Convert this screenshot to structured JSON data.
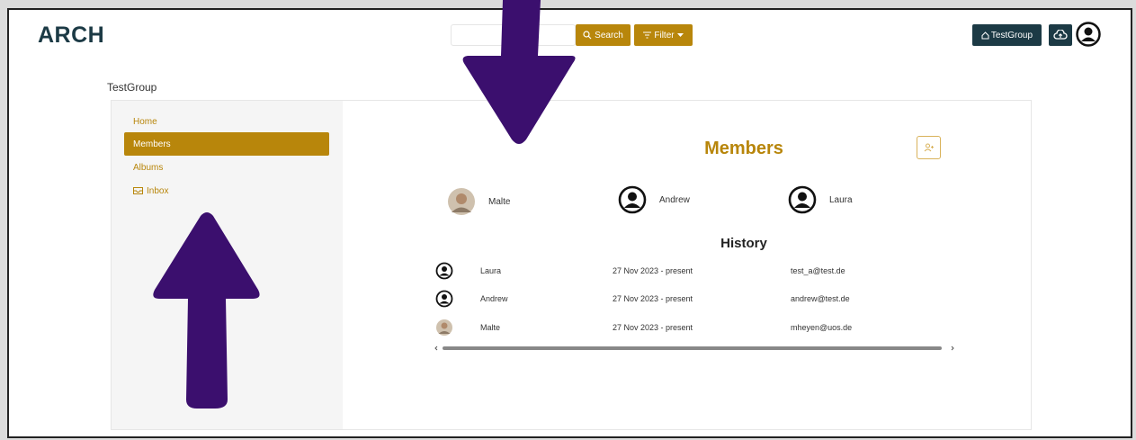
{
  "app": {
    "logo": "ARCH"
  },
  "header": {
    "search_placeholder": "",
    "search_label": "Search",
    "filter_label": "Filter",
    "group_button_label": "TestGroup"
  },
  "group": {
    "name": "TestGroup"
  },
  "sidebar": {
    "items": [
      {
        "label": "Home",
        "active": false
      },
      {
        "label": "Members",
        "active": true
      },
      {
        "label": "Albums",
        "active": false
      },
      {
        "label": "Inbox",
        "active": false
      }
    ]
  },
  "main": {
    "title": "Members",
    "members": [
      {
        "name": "Malte",
        "avatar": "photo"
      },
      {
        "name": "Andrew",
        "avatar": "default"
      },
      {
        "name": "Laura",
        "avatar": "default"
      }
    ],
    "history_title": "History",
    "history": [
      {
        "name": "Laura",
        "period": "27 Nov 2023 - present",
        "email": "test_a@test.de",
        "avatar": "default"
      },
      {
        "name": "Andrew",
        "period": "27 Nov 2023 - present",
        "email": "andrew@test.de",
        "avatar": "default"
      },
      {
        "name": "Malte",
        "period": "27 Nov 2023 - present",
        "email": "mheyen@uos.de",
        "avatar": "photo"
      }
    ]
  },
  "colors": {
    "accent": "#b8860b",
    "dark": "#1c3a45",
    "annotation_arrow": "#3b0f6e"
  },
  "icons": [
    "search-icon",
    "filter-icon",
    "caret-down-icon",
    "home-icon",
    "cloud-upload-icon",
    "user-avatar-icon",
    "inbox-icon",
    "add-member-icon"
  ]
}
